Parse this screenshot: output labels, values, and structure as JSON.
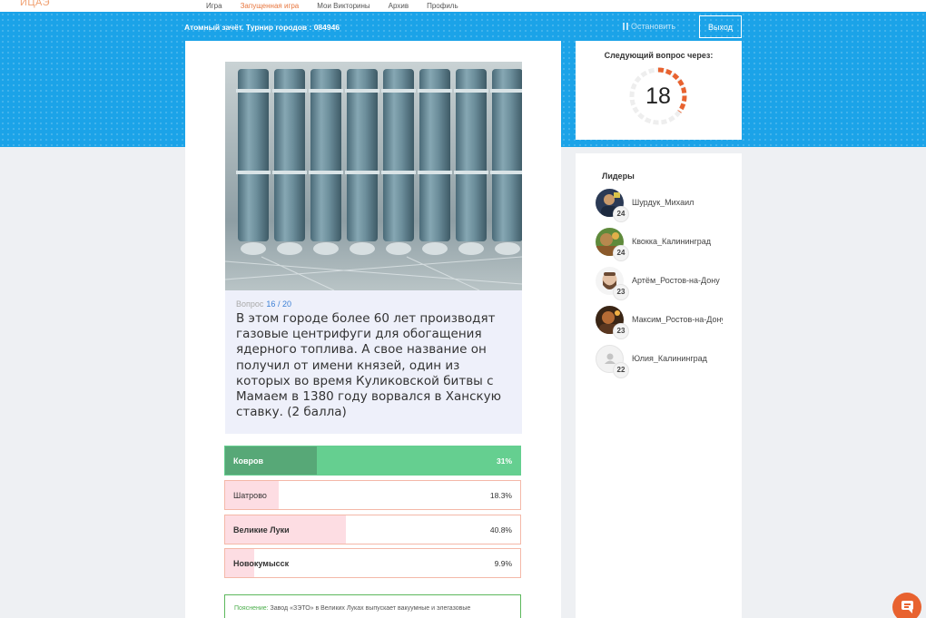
{
  "nav": {
    "logo": "ИЦАЭ",
    "links": [
      "Игра",
      "Запущенная игра",
      "Мои Викторины",
      "Архив",
      "Профиль"
    ],
    "active_index": 1
  },
  "header": {
    "game_title": "Атомный зачёт. Турнир городов : 084946",
    "stop_label": "Остановить",
    "exit_label": "Выход"
  },
  "question": {
    "label": "Вопрос",
    "number": "16",
    "total": "/ 20",
    "text": "В этом городе более 60 лет производят газовые центрифуги для обогащения ядерного топлива. А свое название он получил от имени князей, один из которых во время Куликовской битвы с Мамаем в 1380 году ворвался в Ханскую ставку. (2 балла)"
  },
  "answers": [
    {
      "label": "Ковров",
      "percent": "31%",
      "value": 31,
      "correct": true
    },
    {
      "label": "Шатрово",
      "percent": "18.3%",
      "value": 18.3,
      "correct": false
    },
    {
      "label": "Великие Луки",
      "percent": "40.8%",
      "value": 40.8,
      "correct": false
    },
    {
      "label": "Новокумысск",
      "percent": "9.9%",
      "value": 9.9,
      "correct": false
    }
  ],
  "explanation": {
    "tag": "Пояснение:",
    "text": "Завод «ЗЭТО» в Великих Луках выпускает вакуумные и элегазовые"
  },
  "timer": {
    "title": "Следующий вопрос через:",
    "seconds": "18",
    "fraction_remaining": 0.35,
    "accent_color": "#e8622f"
  },
  "leaders": {
    "title": "Лидеры",
    "items": [
      {
        "name": "Шурдук_Михаил",
        "score": "24",
        "avatar": "photo-avatar"
      },
      {
        "name": "Квокка_Калининград",
        "score": "24",
        "avatar": "photo-avatar"
      },
      {
        "name": "Артём_Ростов-на-Дону",
        "score": "23",
        "avatar": "photo-avatar"
      },
      {
        "name": "Максим_Ростов-на-Дону",
        "score": "23",
        "avatar": "photo-avatar"
      },
      {
        "name": "Юлия_Калининград",
        "score": "22",
        "avatar": "default-user-icon"
      }
    ]
  },
  "colors": {
    "brand_blue": "#1ba3e8",
    "correct_green": "#65cf90",
    "wrong_pink": "#fddde3"
  }
}
